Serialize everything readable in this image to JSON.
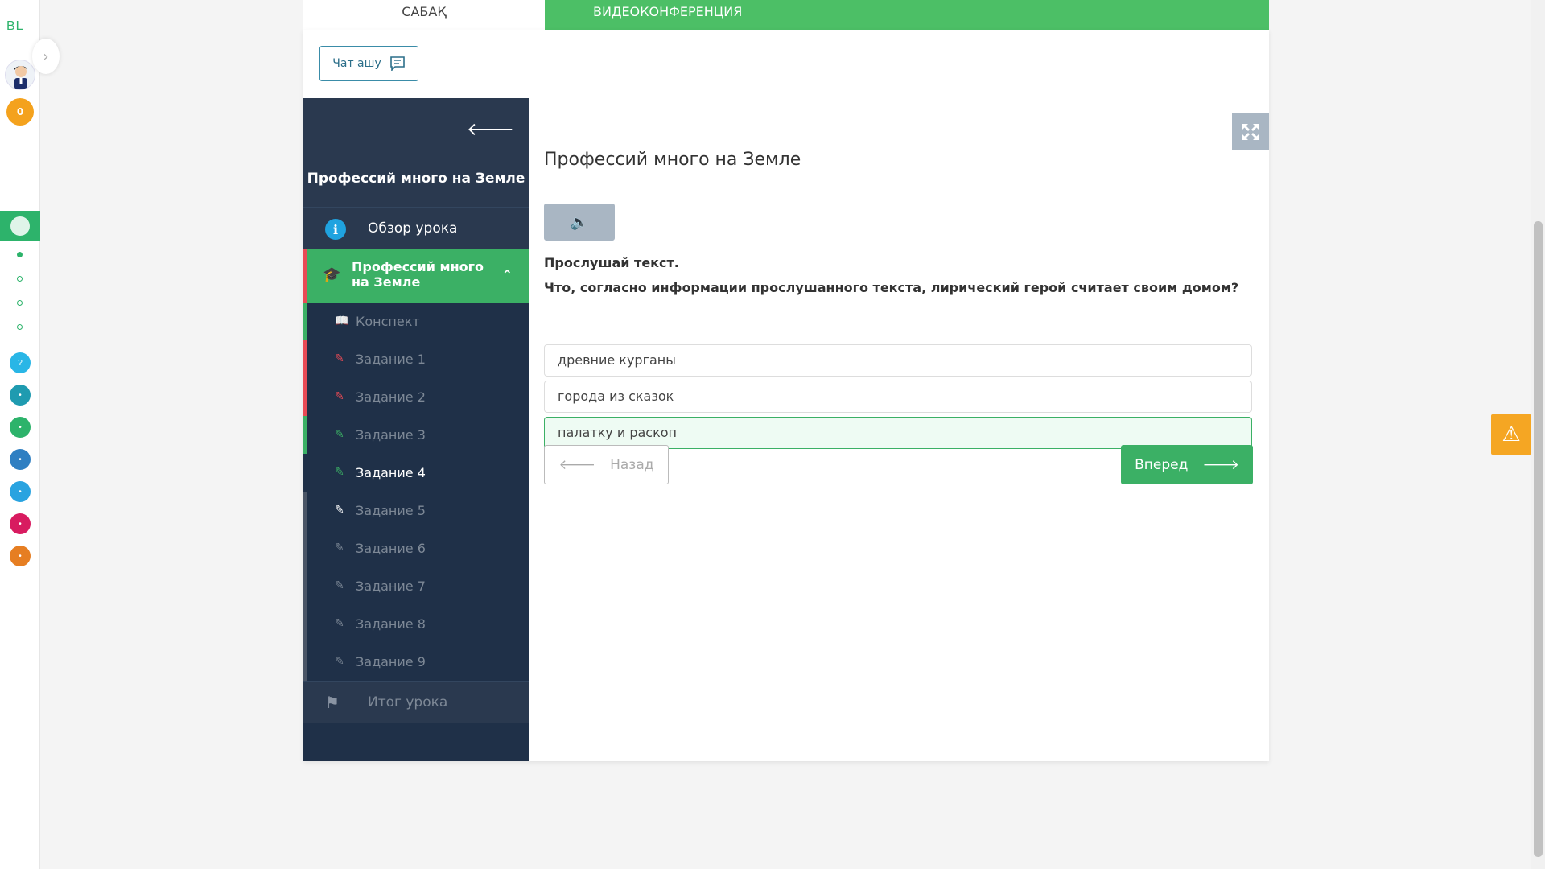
{
  "rail": {
    "logo": "BL",
    "coins": "0",
    "apps": [
      {
        "icon": "question-icon",
        "color": "#29b6e6",
        "glyph": "?"
      },
      {
        "icon": "app-icon-1",
        "color": "#1f9bb0",
        "glyph": "•"
      },
      {
        "icon": "app-icon-2",
        "color": "#2db36b",
        "glyph": "•"
      },
      {
        "icon": "app-icon-3",
        "color": "#2f7fc2",
        "glyph": "•"
      },
      {
        "icon": "app-icon-4",
        "color": "#29a3e0",
        "glyph": "•"
      },
      {
        "icon": "app-icon-5",
        "color": "#d81b60",
        "glyph": "•"
      },
      {
        "icon": "app-icon-6",
        "color": "#e67e22",
        "glyph": "•"
      }
    ]
  },
  "tabs": {
    "lesson": "САБАҚ",
    "video": "ВИДЕОКОНФЕРЕНЦИЯ"
  },
  "chat": {
    "label": "Чат ашу"
  },
  "sidebar": {
    "title": "Профессий много на Земле",
    "overview": "Обзор урока",
    "active_section": "Профессий много на Земле",
    "items": [
      {
        "label": "Конспект",
        "state": "green",
        "icon": "book-icon"
      },
      {
        "label": "Задание 1",
        "state": "red",
        "icon": "edit-icon"
      },
      {
        "label": "Задание 2",
        "state": "red",
        "icon": "edit-icon"
      },
      {
        "label": "Задание 3",
        "state": "green",
        "icon": "edit-icon"
      },
      {
        "label": "Задание 4",
        "state": "current",
        "icon": "edit-icon"
      },
      {
        "label": "Задание 5",
        "state": "grey",
        "icon": "edit-icon"
      },
      {
        "label": "Задание 6",
        "state": "grey",
        "icon": "edit-icon"
      },
      {
        "label": "Задание 7",
        "state": "grey",
        "icon": "edit-icon"
      },
      {
        "label": "Задание 8",
        "state": "grey",
        "icon": "edit-icon"
      },
      {
        "label": "Задание 9",
        "state": "grey",
        "icon": "edit-icon"
      }
    ],
    "final": "Итог урока"
  },
  "main": {
    "title": "Профессий много на Земле",
    "instruction": "Прослушай текст.",
    "question": "Что, согласно информации прослушанного текста, лирический герой считает своим домом?",
    "options": [
      {
        "label": "древние курганы",
        "selected": false
      },
      {
        "label": "города из сказок",
        "selected": false
      },
      {
        "label": "палатку и раскоп",
        "selected": true
      }
    ],
    "back_label": "Назад",
    "next_label": "Вперед"
  },
  "colors": {
    "accent_green": "#3bb065",
    "sidebar_bg": "#1f3048",
    "warning": "#f5a623",
    "error_red": "#e84a55"
  }
}
